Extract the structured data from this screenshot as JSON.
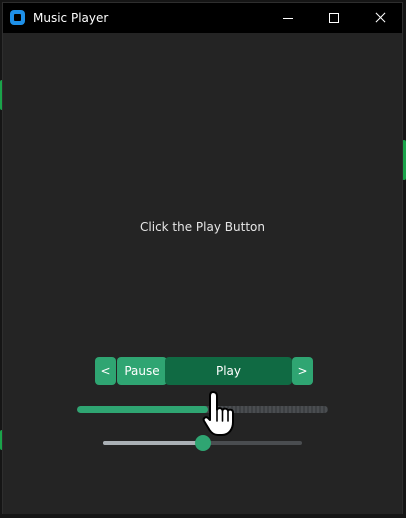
{
  "window": {
    "title": "Music Player"
  },
  "main": {
    "prompt": "Click the Play Button"
  },
  "controls": {
    "prev_label": "<",
    "pause_label": "Pause",
    "play_label": "Play",
    "next_label": ">"
  },
  "progress": {
    "fraction": 0.52
  },
  "volume": {
    "fraction": 0.5
  },
  "icons": {
    "app": "app-square-icon",
    "minimize": "minimize-icon",
    "maximize": "maximize-icon",
    "close": "close-icon",
    "cursor": "hand-pointer-icon"
  },
  "colors": {
    "accent": "#2fa572",
    "accent_dark": "#106a43",
    "background": "#242424",
    "titlebar": "#000000"
  }
}
